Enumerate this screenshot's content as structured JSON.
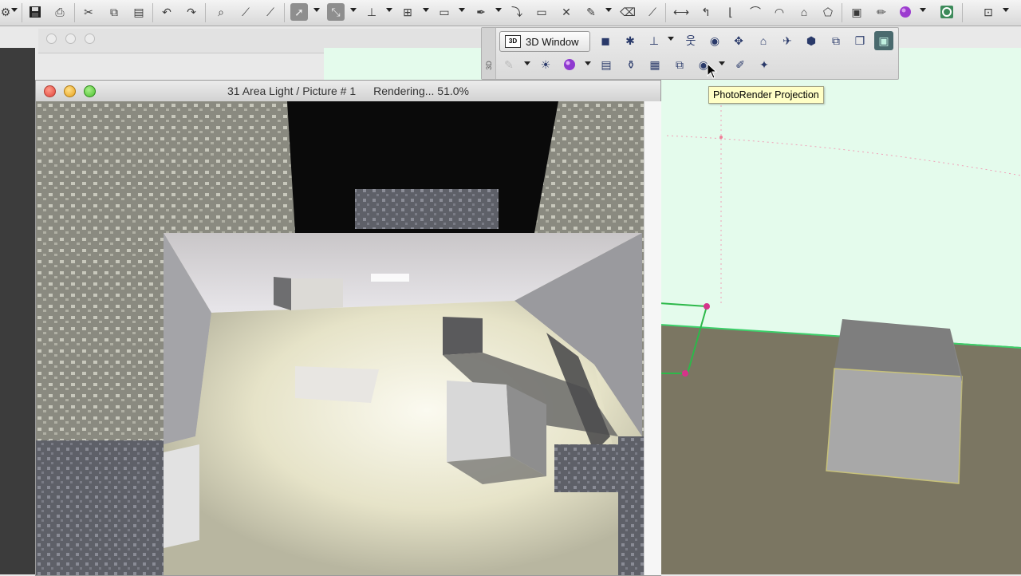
{
  "toolbar": {
    "buttons": [
      "logo-icon",
      "save-icon",
      "print-icon",
      "cut-icon",
      "copy-icon",
      "paste-icon",
      "undo-icon",
      "redo-icon",
      "find-icon",
      "eyedropper-icon",
      "syringe-icon",
      "arrow-tool-icon",
      "marquee-tool-icon",
      "sum-icon",
      "grid-icon",
      "layers-icon",
      "pen-icon",
      "magic-wand-icon",
      "window-icon",
      "close-x-icon",
      "pencil-icon",
      "eraser-icon",
      "ruler-icon",
      "dimension-icon",
      "trace-icon",
      "arc-icon",
      "rotate-icon",
      "mirror-icon",
      "house-icon",
      "brush-icon",
      "palette-icon",
      "info-icon",
      "layout-icon"
    ]
  },
  "palette": {
    "label_3d": "3D",
    "window_button_label": "3D Window",
    "window_button_icon_text": "3D",
    "row1_icons": [
      "cube-icon",
      "camera-icon",
      "axis-icon",
      "walk-icon",
      "orbit-icon",
      "pan-icon",
      "house-icon",
      "flythrough-icon",
      "explore-icon",
      "copy-render-icon",
      "book-icon",
      "navigator-icon"
    ],
    "row2_icons": [
      "lamp-icon",
      "sun-icon",
      "material-icon",
      "photorender-settings-icon",
      "bottle-icon",
      "table-icon",
      "stack-icon",
      "photorender-projection-icon",
      "ruler-tool-icon",
      "light-bulbs-icon"
    ]
  },
  "tooltip": {
    "text": "PhotoRender Projection"
  },
  "render_window": {
    "title": "31 Area Light / Picture # 1",
    "status": "Rendering... 51.0%",
    "progress_percent": 51.0
  },
  "colors": {
    "viewport_sky": "#e4fbec",
    "viewport_ground": "#7b7662",
    "render_floor": "#e9e7d3",
    "selection_green": "#2db84a",
    "selection_magenta": "#d6338a"
  }
}
